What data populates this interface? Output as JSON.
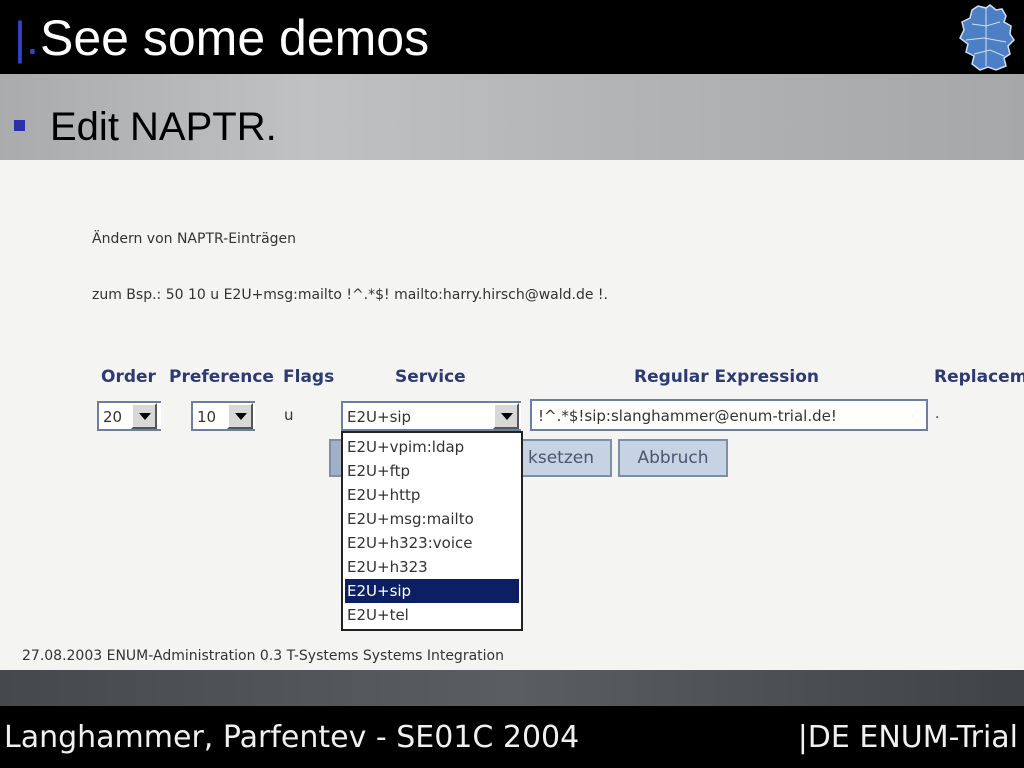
{
  "slide": {
    "title_mark": "|.",
    "title": "See some demos",
    "bullet": "Edit NAPTR.",
    "logo_icon": "germany-map-icon"
  },
  "app": {
    "heading": "Ändern von NAPTR-Einträgen",
    "example": "zum Bsp.: 50 10 u E2U+msg:mailto !^.*$! mailto:harry.hirsch@wald.de !.",
    "columns": {
      "order": "Order",
      "preference": "Preference",
      "flags": "Flags",
      "service": "Service",
      "regex": "Regular Expression",
      "replacement": "Replacem"
    },
    "row": {
      "order_value": "20",
      "preference_value": "10",
      "flags_value": "u",
      "service_value": "E2U+sip",
      "regex_value": "!^.*$!sip:slanghammer@enum-trial.de!",
      "replacement_value": "."
    },
    "buttons": {
      "reset_label": "ksetzen",
      "cancel_label": "Abbruch"
    },
    "service_options": [
      "E2U+vpim:ldap",
      "E2U+ftp",
      "E2U+http",
      "E2U+msg:mailto",
      "E2U+h323:voice",
      "E2U+h323",
      "E2U+sip",
      "E2U+tel"
    ],
    "selected_option": "E2U+sip",
    "footer": "27.08.2003 ENUM-Administration 0.3 T-Systems Systems Integration"
  },
  "footer": {
    "left": "Langhammer, Parfentev - SE01C 2004",
    "right": "|DE ENUM-Trial"
  },
  "colors": {
    "accent": "#3344cc",
    "header_text": "#2c3b74",
    "selected_bg": "#0d1f63"
  }
}
